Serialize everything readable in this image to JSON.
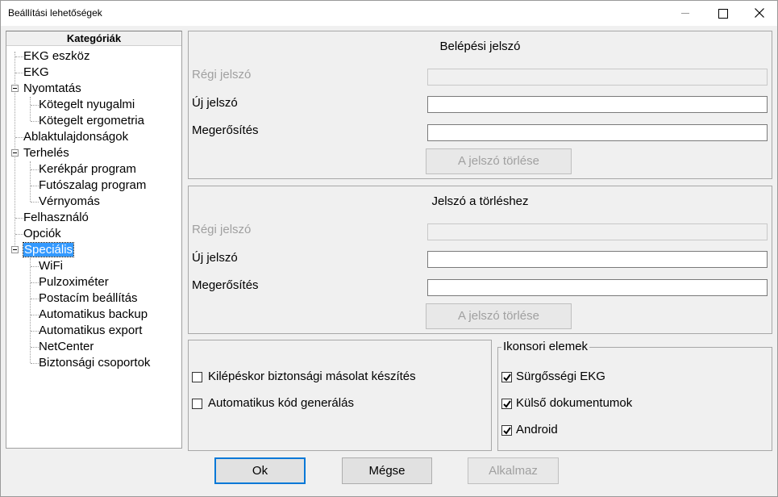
{
  "window": {
    "title": "Beállítási lehetőségek"
  },
  "tree": {
    "header": "Kategóriák",
    "items": [
      {
        "label": "EKG eszköz"
      },
      {
        "label": "EKG"
      },
      {
        "label": "Nyomtatás"
      },
      {
        "label": "Kötegelt nyugalmi"
      },
      {
        "label": "Kötegelt ergometria"
      },
      {
        "label": "Ablaktulajdonságok"
      },
      {
        "label": "Terhelés"
      },
      {
        "label": "Kerékpár program"
      },
      {
        "label": "Futószalag program"
      },
      {
        "label": "Vérnyomás"
      },
      {
        "label": "Felhasználó"
      },
      {
        "label": "Opciók"
      },
      {
        "label": "Speciális"
      },
      {
        "label": "WiFi"
      },
      {
        "label": "Pulzoximéter"
      },
      {
        "label": "Postacím beállítás"
      },
      {
        "label": "Automatikus backup"
      },
      {
        "label": "Automatikus export"
      },
      {
        "label": "NetCenter"
      },
      {
        "label": "Biztonsági csoportok"
      }
    ]
  },
  "login_password": {
    "title": "Belépési jelszó",
    "old_label": "Régi jelszó",
    "new_label": "Új jelszó",
    "confirm_label": "Megerősítés",
    "old_value": "",
    "new_value": "",
    "confirm_value": "",
    "clear_button": "A jelszó törlése"
  },
  "delete_password": {
    "title": "Jelszó a törléshez",
    "old_label": "Régi jelszó",
    "new_label": "Új jelszó",
    "confirm_label": "Megerősítés",
    "old_value": "",
    "new_value": "",
    "confirm_value": "",
    "clear_button": "A jelszó törlése"
  },
  "options": {
    "backup_on_exit": {
      "label": "Kilépéskor biztonsági másolat készítés",
      "checked": false
    },
    "auto_code": {
      "label": "Automatikus kód generálás",
      "checked": false
    }
  },
  "toolbar_items": {
    "legend": "Ikonsori elemek",
    "items": [
      {
        "label": "Sürgősségi EKG",
        "checked": true
      },
      {
        "label": "Külső dokumentumok",
        "checked": true
      },
      {
        "label": "Android",
        "checked": true
      }
    ]
  },
  "footer": {
    "ok": "Ok",
    "cancel": "Mégse",
    "apply": "Alkalmaz"
  }
}
